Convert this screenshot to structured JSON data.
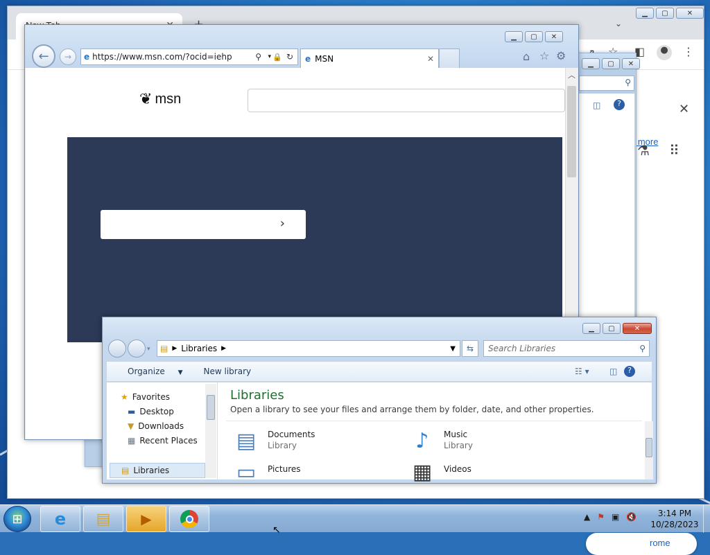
{
  "chrome": {
    "tab_title": "New Tab",
    "learn_more": "n more",
    "customize": "rome"
  },
  "ie": {
    "url": "https://www.msn.com/?ocid=iehp",
    "tab_title": "MSN",
    "logo_text": "msn"
  },
  "explorer": {
    "breadcrumb": "Libraries",
    "search_placeholder": "Search Libraries",
    "organize": "Organize",
    "new_library": "New library",
    "tree": [
      "Favorites",
      "Desktop",
      "Downloads",
      "Recent Places",
      "Libraries"
    ],
    "title": "Libraries",
    "subtitle": "Open a library to see your files and arrange them by folder, date, and other properties.",
    "items": [
      {
        "name": "Documents",
        "kind": "Library"
      },
      {
        "name": "Music",
        "kind": "Library"
      },
      {
        "name": "Pictures",
        "kind": ""
      },
      {
        "name": "Videos",
        "kind": ""
      }
    ]
  },
  "taskbar": {
    "time": "3:14 PM",
    "date": "10/28/2023"
  }
}
